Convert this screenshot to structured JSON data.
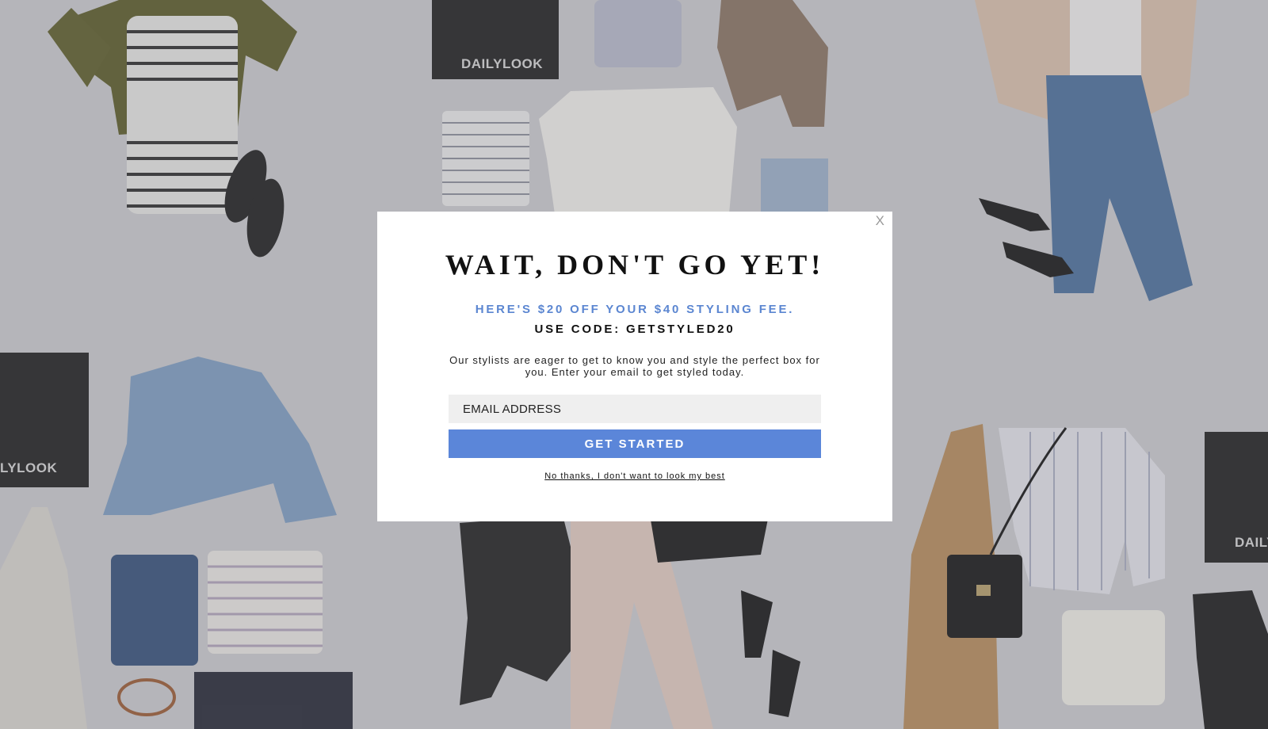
{
  "background": {
    "brand_box_text": "DAILYLOOK",
    "brand_box_text_partial_left": "LYLOOK",
    "brand_box_text_partial_right": "DAILY"
  },
  "modal": {
    "close_label": "X",
    "title": "WAIT, DON'T GO YET!",
    "offer": "HERE'S $20 OFF YOUR $40 STYLING FEE.",
    "code_line": "USE CODE: GETSTYLED20",
    "description": "Our stylists are eager to get to know you and style the perfect box for you. Enter your email to get styled today.",
    "email_placeholder": "EMAIL ADDRESS",
    "email_value": "",
    "cta_label": "GET STARTED",
    "decline_link": "No thanks, I don't want to look my best"
  },
  "colors": {
    "accent": "#5b86d9",
    "offer_text": "#5b86d1",
    "backdrop": "#c8c8cc"
  }
}
